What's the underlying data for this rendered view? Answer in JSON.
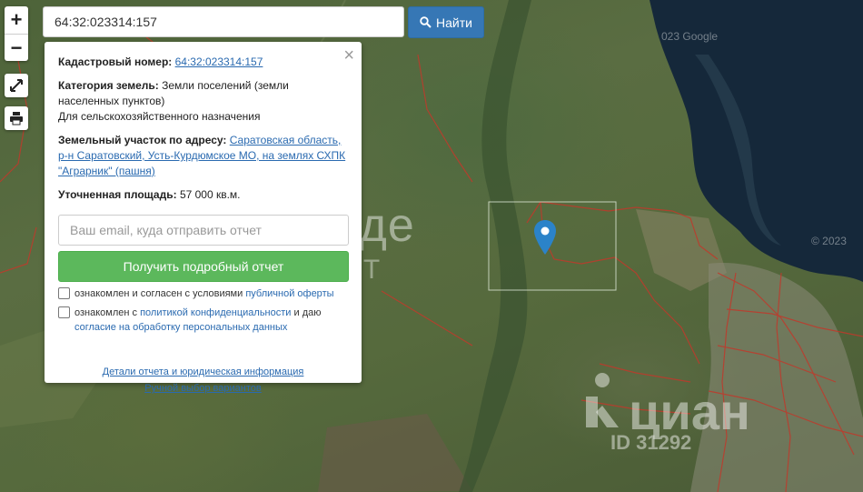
{
  "search": {
    "value": "64:32:023314:157",
    "button_label": "Найти"
  },
  "map": {
    "zoom_in": "+",
    "zoom_out": "−",
    "watermark_google": "023 Google",
    "watermark_year": "© 2023",
    "watermark_agency": "Акаде",
    "watermark_agency_sub": "АГЕНТ",
    "watermark_cian": "циан",
    "watermark_id": "ID 31292"
  },
  "panel": {
    "close": "×",
    "cadastral_label": "Кадастровый номер:",
    "cadastral_value": "64:32:023314:157",
    "category_label": "Категория земель:",
    "category_value": "Земли поселений (земли населенных пунктов)",
    "category_purpose": "Для сельскохозяйственного назначения",
    "address_label": "Земельный участок по адресу:",
    "address_value": "Саратовская область, р-н Саратовский, Усть-Курдюмское МО, на землях СХПК \"Аграрник\" (пашня)",
    "area_label": "Уточненная площадь:",
    "area_value": "57 000 кв.м.",
    "email_placeholder": "Ваш email, куда отправить отчет",
    "report_button": "Получить подробный отчет",
    "consent1_text": "ознакомлен и согласен с условиями",
    "consent1_link": "публичной оферты",
    "consent2_text": "ознакомлен с",
    "consent2_link": "политикой конфиденциальности",
    "consent2_mid": "и даю",
    "consent2_link2": "согласие на обработку персональных данных",
    "details_link": "Детали отчета и юридическая информация",
    "manual_link": "Ручной выбор вариантов"
  },
  "colors": {
    "accent": "#3677b5",
    "button_green": "#5cb85c",
    "marker": "#2b83c9",
    "parcel_border": "#c0392b"
  }
}
